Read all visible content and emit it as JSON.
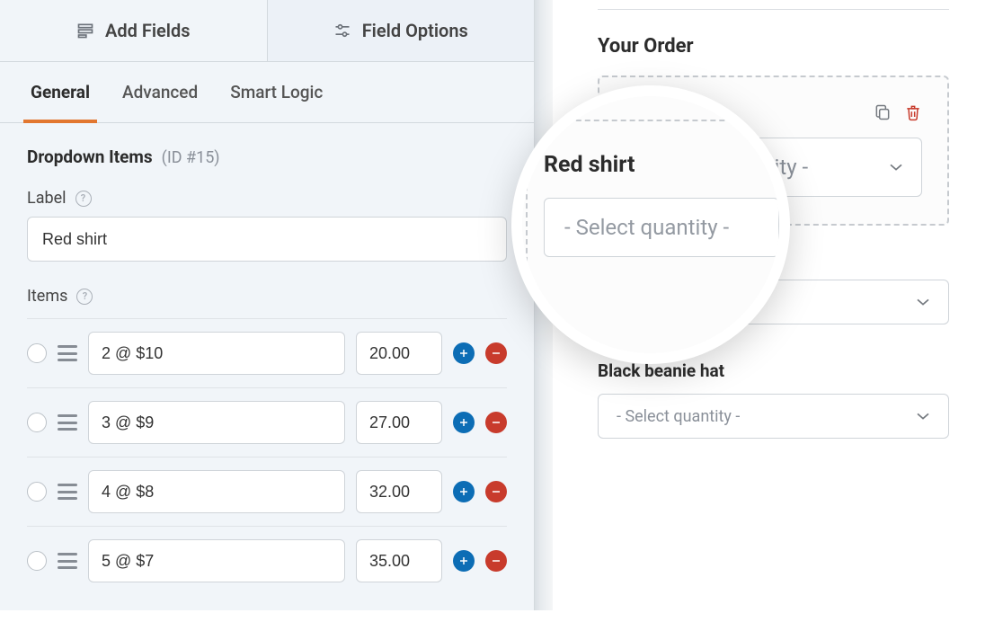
{
  "top_tabs": {
    "add_fields": "Add Fields",
    "field_options": "Field Options"
  },
  "sub_tabs": {
    "general": "General",
    "advanced": "Advanced",
    "smart_logic": "Smart Logic"
  },
  "section": {
    "title": "Dropdown Items",
    "id_text": "(ID #15)"
  },
  "label_field": {
    "label": "Label",
    "value": "Red shirt"
  },
  "items_field": {
    "label": "Items",
    "rows": [
      {
        "text": "2 @ $10",
        "price": "20.00"
      },
      {
        "text": "3 @ $9",
        "price": "27.00"
      },
      {
        "text": "4 @ $8",
        "price": "32.00"
      },
      {
        "text": "5 @ $7",
        "price": "35.00"
      }
    ]
  },
  "preview": {
    "order_title": "Your Order",
    "red_shirt": {
      "label": "Red shirt",
      "placeholder": "- Select quantity -"
    },
    "mid_placeholder": "- Select quantity -",
    "black_beanie": {
      "label": "Black beanie hat",
      "placeholder": "- Select quantity -"
    }
  }
}
